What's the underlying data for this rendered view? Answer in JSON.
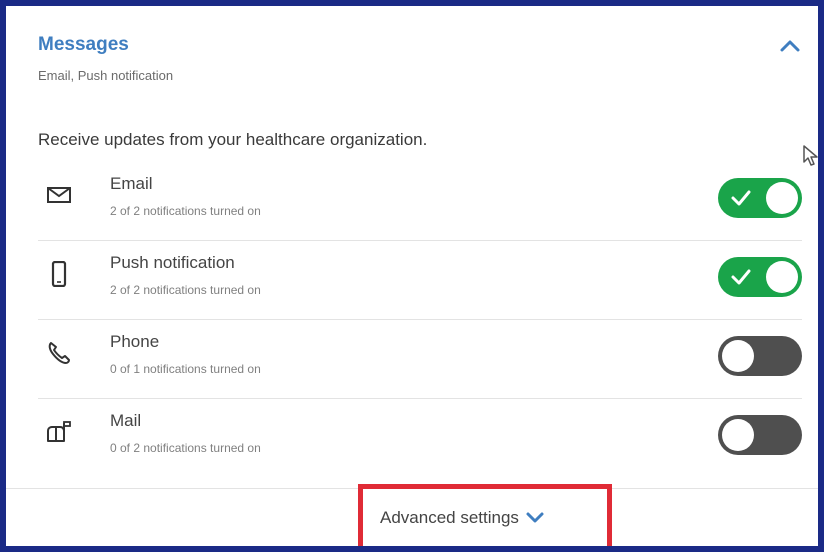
{
  "section": {
    "title": "Messages",
    "subtitle": "Email, Push notification",
    "collapse_icon": "chevron-up-icon",
    "description": "Receive updates from your healthcare organization."
  },
  "channels": [
    {
      "label": "Email",
      "detail": "2 of 2 notifications turned on",
      "enabled": true,
      "icon": "envelope-icon"
    },
    {
      "label": "Push notification",
      "detail": "2 of 2 notifications turned on",
      "enabled": true,
      "icon": "mobile-phone-icon"
    },
    {
      "label": "Phone",
      "detail": "0 of 1 notifications turned on",
      "enabled": false,
      "icon": "phone-icon"
    },
    {
      "label": "Mail",
      "detail": "0 of 2 notifications turned on",
      "enabled": false,
      "icon": "mailbox-icon"
    }
  ],
  "footer": {
    "advanced_label": "Advanced settings",
    "advanced_icon": "chevron-down-icon"
  },
  "colors": {
    "accent": "#3f7ec0",
    "toggle_on": "#1aa44a",
    "toggle_off": "#4f4f4f",
    "frame": "#1a2a86",
    "highlight": "#e02b36"
  }
}
